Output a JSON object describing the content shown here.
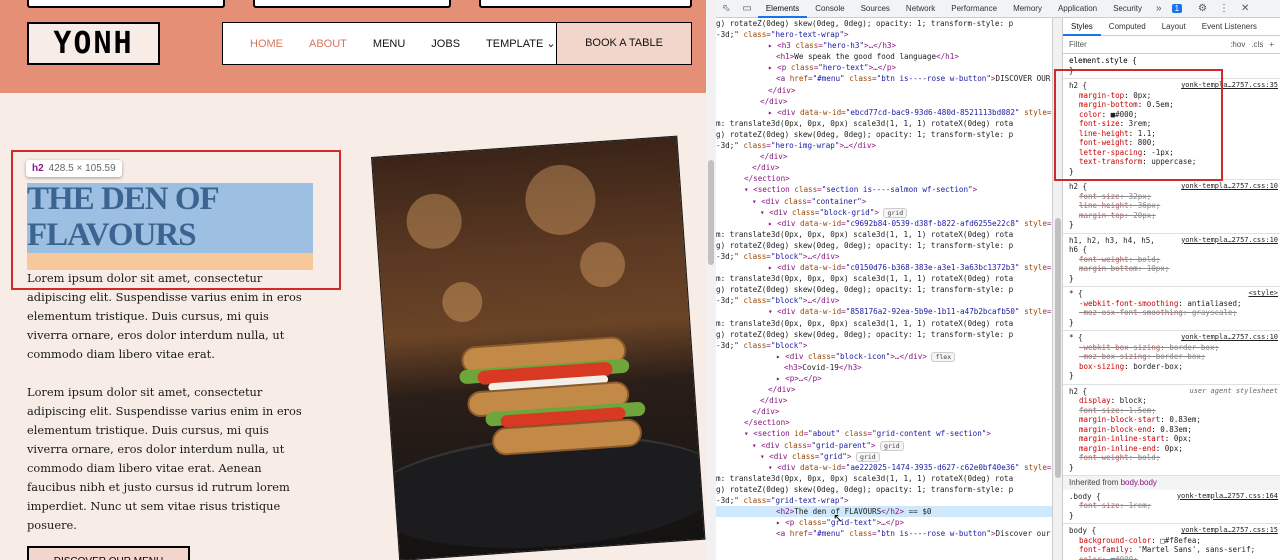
{
  "site": {
    "logo": "YONH",
    "nav": [
      {
        "label": "HOME",
        "active": true
      },
      {
        "label": "ABOUT",
        "active": true
      },
      {
        "label": "MENU",
        "active": false
      },
      {
        "label": "JOBS",
        "active": false
      },
      {
        "label": "TEMPLATE",
        "active": false
      }
    ],
    "book_label": "BOOK A TABLE",
    "tooltip_tag": "h2",
    "tooltip_size": "428.5 × 105.59",
    "heading": "The den of flavours",
    "paragraph1": "Lorem ipsum dolor sit amet, consectetur adipiscing elit. Suspendisse varius enim in eros elementum tristique. Duis cursus, mi quis viverra ornare, eros dolor interdum nulla, ut commodo diam libero vitae erat.",
    "paragraph2": "Lorem ipsum dolor sit amet, consectetur adipiscing elit. Suspendisse varius enim in eros elementum tristique. Duis cursus, mi quis viverra ornare, eros dolor interdum nulla, ut commodo diam libero vitae erat. Aenean faucibus nibh et justo cursus id rutrum lorem imperdiet. Nunc ut sem vitae risus tristique posuere.",
    "cta_label": "DISCOVER OUR MENU",
    "colors": {
      "header": "#e58f76",
      "page": "#f8ece6",
      "accent": "#d9765b",
      "highlight": "#d12a2a"
    }
  },
  "devtools": {
    "tabs": [
      "Elements",
      "Console",
      "Sources",
      "Network",
      "Performance",
      "Memory",
      "Application",
      "Security"
    ],
    "active_tab": "Elements",
    "issues_count": "1",
    "styles_tabs": [
      "Styles",
      "Computed",
      "Layout",
      "Event Listeners"
    ],
    "filter_placeholder": "Filter",
    "hov": ":hov",
    "cls": ".cls",
    "element_style": "element.style {",
    "inherited_label": "Inherited from",
    "inherited_from": "body.body"
  }
}
